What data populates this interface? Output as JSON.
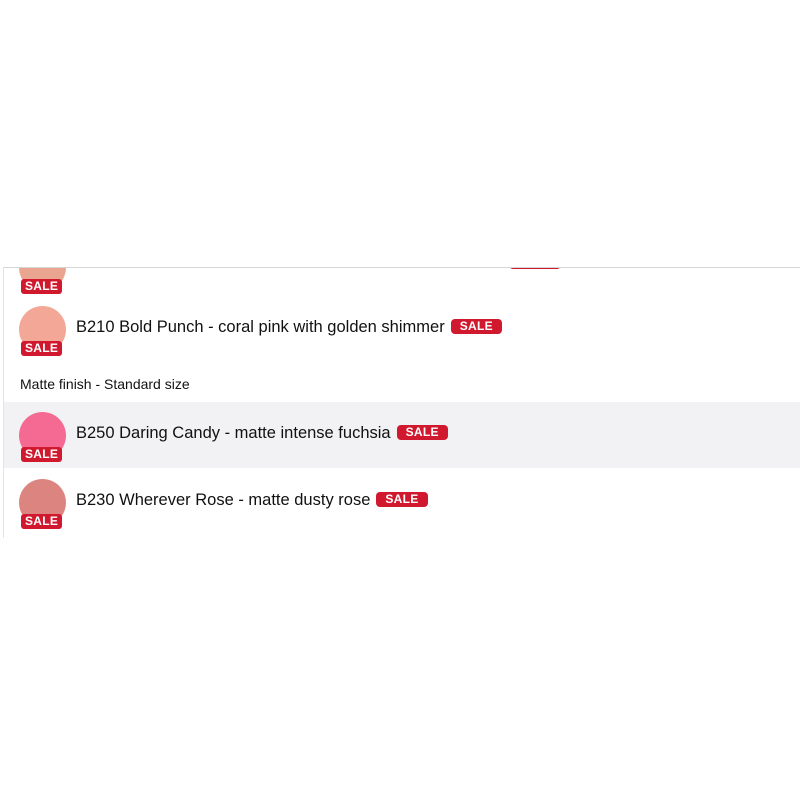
{
  "dropdown": {
    "items": [
      {
        "code": "",
        "label": "",
        "badge": "SALE",
        "swatch_color": "#e9a58f",
        "partially_hidden": true
      },
      {
        "label": "B210 Bold Punch - coral pink with golden shimmer",
        "badge": "SALE",
        "swatch_color": "#f3a897",
        "highlighted": false
      },
      {
        "label": "B250 Daring Candy - matte intense fuchsia",
        "badge": "SALE",
        "swatch_color": "#f56a93",
        "highlighted": true
      },
      {
        "label": "B230 Wherever Rose - matte dusty rose",
        "badge": "SALE",
        "swatch_color": "#dc8580",
        "highlighted": false
      }
    ],
    "group_header": "Matte finish - Standard size",
    "badge_color": "#d0192e"
  }
}
